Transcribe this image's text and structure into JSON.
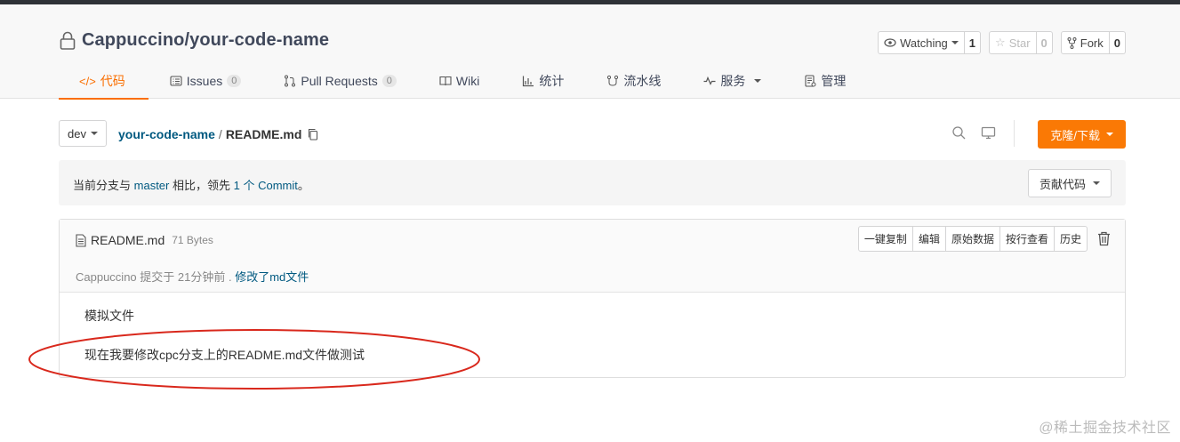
{
  "repo": {
    "full_name": "Cappuccino/your-code-name"
  },
  "actions": {
    "watch_label": "Watching",
    "watch_count": "1",
    "star_label": "Star",
    "star_count": "0",
    "fork_label": "Fork",
    "fork_count": "0"
  },
  "tabs": [
    {
      "label": "代码",
      "icon": "code-icon",
      "active": true
    },
    {
      "label": "Issues",
      "icon": "issues-icon",
      "badge": "0"
    },
    {
      "label": "Pull Requests",
      "icon": "pull-request-icon",
      "badge": "0"
    },
    {
      "label": "Wiki",
      "icon": "book-icon"
    },
    {
      "label": "统计",
      "icon": "bar-chart-icon"
    },
    {
      "label": "流水线",
      "icon": "pipeline-icon"
    },
    {
      "label": "服务",
      "icon": "pulse-icon"
    },
    {
      "label": "管理",
      "icon": "settings-doc-icon"
    }
  ],
  "path": {
    "branch": "dev",
    "repo_name": "your-code-name",
    "separator": "/",
    "file": "README.md"
  },
  "clone_label": "克隆/下载",
  "notice": {
    "prefix": "当前分支与",
    "branch": "master",
    "middle": "相比，领先",
    "commit_count_link": "1 个 Commit",
    "suffix": "。",
    "contribute_label": "贡献代码"
  },
  "file": {
    "name": "README.md",
    "size": "71 Bytes",
    "commit_author_time": "Cappuccino 提交于 21分钟前 .",
    "commit_message": "修改了md文件",
    "buttons": [
      "一键复制",
      "编辑",
      "原始数据",
      "按行查看",
      "历史"
    ],
    "content": [
      "模拟文件",
      "现在我要修改cpc分支上的README.md文件做测试"
    ]
  },
  "colors": {
    "accent": "#fa6e00",
    "link": "#005980",
    "annotation": "#d9281c"
  },
  "watermark": "@稀土掘金技术社区"
}
